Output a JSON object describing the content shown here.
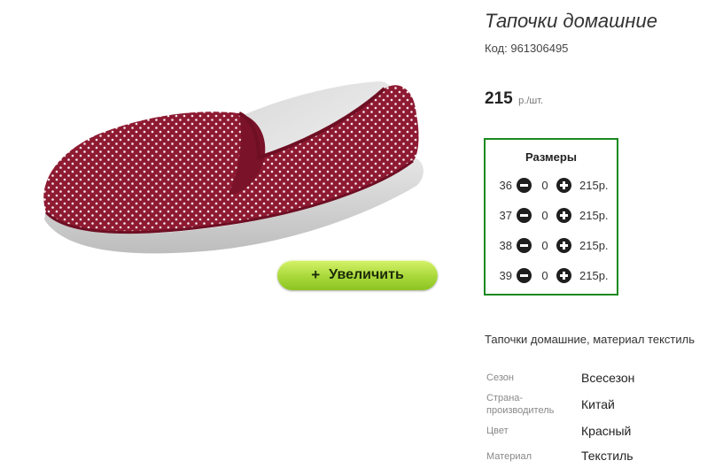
{
  "product": {
    "title": "Тапочки домашние",
    "code_label": "Код:",
    "code_value": "961306495",
    "price_value": "215",
    "price_unit": "р./шт.",
    "description": "Тапочки домашние, материал текстиль"
  },
  "image": {
    "zoom_label": "Увеличить",
    "zoom_plus": "+"
  },
  "sizes": {
    "title": "Размеры",
    "rows": [
      {
        "size": "36",
        "qty": "0",
        "price": "215р."
      },
      {
        "size": "37",
        "qty": "0",
        "price": "215р."
      },
      {
        "size": "38",
        "qty": "0",
        "price": "215р."
      },
      {
        "size": "39",
        "qty": "0",
        "price": "215р."
      }
    ]
  },
  "attributes": [
    {
      "label": "Сезон",
      "value": "Всесезон"
    },
    {
      "label": "Страна-производитель",
      "value": "Китай"
    },
    {
      "label": "Цвет",
      "value": "Красный"
    },
    {
      "label": "Материал",
      "value": "Текстиль"
    }
  ],
  "colors": {
    "accent_green": "#1a8a1f",
    "button_green": "#a8d83a",
    "shoe_red": "#8e1a32"
  }
}
